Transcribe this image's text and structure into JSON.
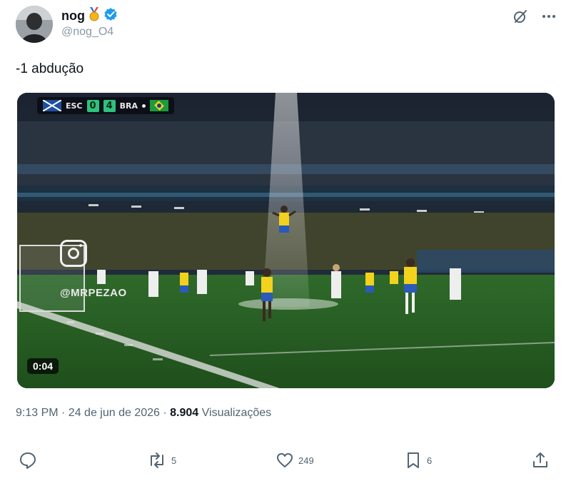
{
  "author": {
    "display_name": "nog",
    "handle": "@nog_O4",
    "badge_icon": "medal-icon",
    "verified_icon": "verified-badge-icon",
    "verified_color": "#1d9bf0"
  },
  "top_icons": [
    "grok-icon",
    "more-icon"
  ],
  "tweet": {
    "text": "-1 abdução"
  },
  "video": {
    "scoreboard": {
      "home_abbr": "ESC",
      "home_score": "0",
      "away_score": "4",
      "away_abbr": "BRA"
    },
    "watermark": "@MRPEZAO",
    "duration": "0:04"
  },
  "meta": {
    "timestamp": "9:13 PM · 24 de jun de 2026 · ",
    "views_count": "8.904",
    "views_label": " Visualizações"
  },
  "actions": {
    "replies": {
      "icon": "reply-icon",
      "count": ""
    },
    "reposts": {
      "icon": "repost-icon",
      "count": "5"
    },
    "likes": {
      "icon": "like-icon",
      "count": "249"
    },
    "bookmarks": {
      "icon": "bookmark-icon",
      "count": "6"
    },
    "share": {
      "icon": "share-icon"
    }
  },
  "colors": {
    "text_primary": "#0f1419",
    "text_secondary": "#536471",
    "accent": "#1d9bf0"
  }
}
